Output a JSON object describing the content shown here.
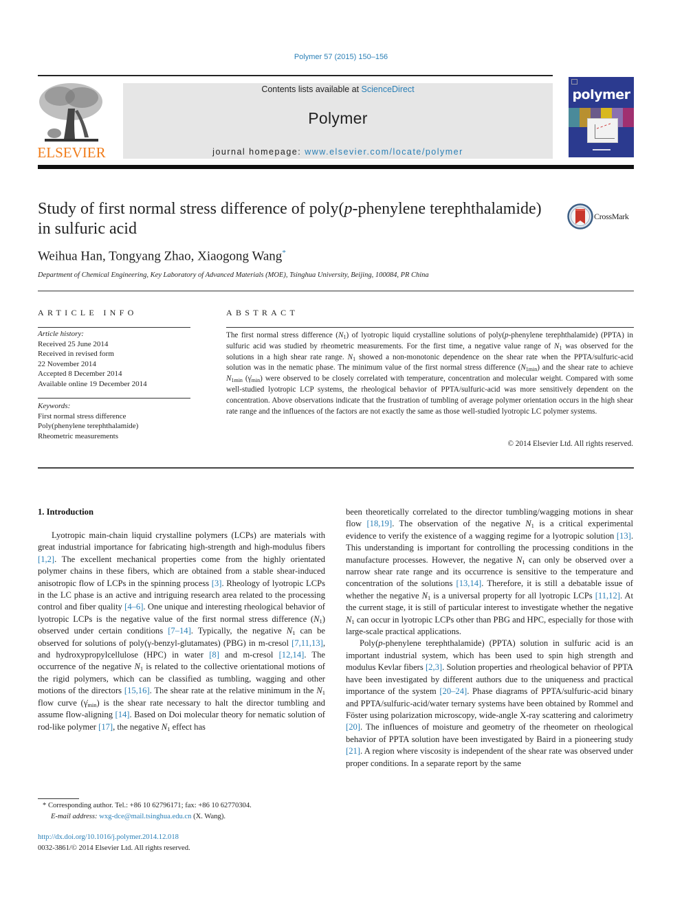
{
  "header": {
    "citation": "Polymer 57 (2015) 150–156",
    "contents_prefix": "Contents lists available at ",
    "contents_link": "ScienceDirect",
    "journal_name": "Polymer",
    "homepage_prefix": "journal homepage: ",
    "homepage_link": "www.elsevier.com/locate/polymer",
    "publisher_logo_text": "ELSEVIER",
    "cover_title": "polymer"
  },
  "colors": {
    "link": "#2a7fb6",
    "elsevier_orange": "#f07c1a",
    "cover_blue": "#2b3a8f",
    "masthead_gray": "#e6e6e6"
  },
  "article": {
    "title_part1": "Study of first normal stress difference of poly(",
    "title_italic": "p",
    "title_part2": "-phenylene terephthalamide) in sulfuric acid",
    "crossmark_label": "CrossMark",
    "authors": "Weihua Han, Tongyang Zhao, Xiaogong Wang",
    "author_mark": "*",
    "affiliation": "Department of Chemical Engineering, Key Laboratory of Advanced Materials (MOE), Tsinghua University, Beijing, 100084, PR China"
  },
  "article_info": {
    "heading": "ARTICLE INFO",
    "history_label": "Article history:",
    "history": [
      "Received 25 June 2014",
      "Received in revised form",
      "22 November 2014",
      "Accepted 8 December 2014",
      "Available online 19 December 2014"
    ],
    "keywords_label": "Keywords:",
    "keywords": [
      "First normal stress difference",
      "Poly(phenylene terephthalamide)",
      "Rheometric measurements"
    ]
  },
  "abstract": {
    "heading": "ABSTRACT",
    "s1": "The first normal stress difference (",
    "s2": ") of lyotropic liquid crystalline solutions of poly(",
    "s3": "-phenylene terephthalamide) (PPTA) in sulfuric acid was studied by rheometric measurements. For the first time, a negative value range of ",
    "s4": " was observed for the solutions in a high shear rate range. ",
    "s5": " showed a non-monotonic dependence on the shear rate when the PPTA/sulfuric-acid solution was in the nematic phase. The minimum value of the first normal stress difference (",
    "s6": ") and the shear rate to achieve ",
    "s7": " (",
    "s8": ") were observed to be closely correlated with temperature, concentration and molecular weight. Compared with some well-studied lyotropic LCP systems, the rheological behavior of PPTA/sulfuric-acid was more sensitively dependent on the concentration. Above observations indicate that the frustration of tumbling of average polymer orientation occurs in the high shear rate range and the influences of the factors are not exactly the same as those well-studied lyotropic LC polymer systems.",
    "copyright": "© 2014 Elsevier Ltd. All rights reserved."
  },
  "symbols": {
    "N": "N",
    "sub1": "1",
    "sub1min": "1min",
    "p": "p",
    "gamma_dot": "γ̇",
    "min": "min",
    "gamma": "γ"
  },
  "intro": {
    "heading": "1.  Introduction",
    "p1": {
      "t1": "Lyotropic main-chain liquid crystalline polymers (LCPs) are materials with great industrial importance for fabricating high-strength and high-modulus fibers ",
      "r1": "[1,2]",
      "t2": ". The excellent mechanical properties come from the highly orientated polymer chains in these fibers, which are obtained from a stable shear-induced anisotropic flow of LCPs in the spinning process ",
      "r2": "[3]",
      "t3": ". Rheology of lyotropic LCPs in the LC phase is an active and intriguing research area related to the processing control and fiber quality ",
      "r3": "[4–6]",
      "t4": ". One unique and interesting rheological behavior of lyotropic LCPs is the negative value of the first normal stress difference (",
      "t5": ") observed under certain conditions ",
      "r4": "[7–14]",
      "t6": ". Typically, the negative ",
      "t7": " can be observed for solutions of poly(",
      "t8": "-benzyl-glutamates) (PBG) in m-cresol ",
      "r5": "[7,11,13]",
      "t9": ", and hydroxypropylcellulose (HPC) in water ",
      "r6": "[8]",
      "t10": " and m-cresol ",
      "r7": "[12,14]",
      "t11": ". The occurrence of the negative ",
      "t12": " is related to the collective orientational motions of the rigid polymers, which can be classified as tumbling, wagging and other motions of the directors ",
      "r8": "[15,16]",
      "t13": ". The shear rate at the relative minimum in the ",
      "t14": " flow curve (",
      "t15": ") is the shear rate necessary to halt the director tumbling and assume flow-aligning ",
      "r9": "[14]",
      "t16": ". Based on Doi molecular theory for nematic solution of rod-like polymer ",
      "r10": "[17]",
      "t17": ", the negative ",
      "t18": " effect has been theoretically correlated to the director tumbling/wagging motions in shear flow ",
      "r11": "[18,19]",
      "t19": ". The observation of the negative ",
      "t20": " is a critical experimental evidence to verify the existence of a wagging regime for a lyotropic solution ",
      "r12": "[13]",
      "t21": ". This understanding is important for controlling the processing conditions in the manufacture processes. However, the negative ",
      "t22": " can only be observed over a narrow shear rate range and its occurrence is sensitive to the temperature and concentration of the solutions ",
      "r13": "[13,14]",
      "t23": ". Therefore, it is still a debatable issue of whether the negative ",
      "t24": " is a universal property for all lyotropic LCPs ",
      "r14": "[11,12]",
      "t25": ". At the current stage, it is still of particular interest to investigate whether the negative ",
      "t26": " can occur in lyotropic LCPs other than PBG and HPC, especially for those with large-scale practical applications."
    },
    "p2": {
      "t1": "Poly(",
      "t2": "-phenylene terephthalamide) (PPTA) solution in sulfuric acid is an important industrial system, which has been used to spin high strength and modulus Kevlar fibers ",
      "r1": "[2,3]",
      "t3": ". Solution properties and rheological behavior of PPTA have been investigated by different authors due to the uniqueness and practical importance of the system ",
      "r2": "[20–24]",
      "t4": ". Phase diagrams of PPTA/sulfuric-acid binary and PPTA/sulfuric-acid/water ternary systems have been obtained by Rommel and Föster using polarization microscopy, wide-angle X-ray scattering and calorimetry ",
      "r3": "[20]",
      "t5": ". The influences of moisture and geometry of the rheometer on rheological behavior of PPTA solution have been investigated by Baird in a pioneering study ",
      "r4": "[21]",
      "t6": ". A region where viscosity is independent of the shear rate was observed under proper conditions. In a separate report by the same"
    }
  },
  "footnote": {
    "mark": "*",
    "corresponding": " Corresponding author. Tel.: +86 10 62796171; fax: +86 10 62770304.",
    "email_label": "E-mail address:",
    "email": "wxg-dce@mail.tsinghua.edu.cn",
    "email_suffix": " (X. Wang).",
    "doi": "http://dx.doi.org/10.1016/j.polymer.2014.12.018",
    "issn": "0032-3861/© 2014 Elsevier Ltd. All rights reserved."
  }
}
